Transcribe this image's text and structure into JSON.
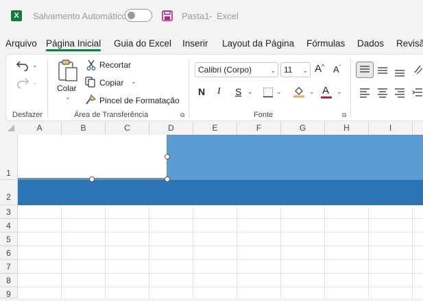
{
  "titlebar": {
    "logo": "X",
    "autosave_label": "Salvamento Automático",
    "autosave_state": "off",
    "filename": "Pasta1",
    "separator": "-",
    "app": "Excel"
  },
  "tabs": [
    {
      "label": "Arquivo"
    },
    {
      "label": "Página Inicial",
      "active": true
    },
    {
      "label": "Guia do Excel"
    },
    {
      "label": "Inserir"
    },
    {
      "label": "Layout da Página"
    },
    {
      "label": "Fórmulas"
    },
    {
      "label": "Dados"
    },
    {
      "label": "Revisão"
    }
  ],
  "ribbon": {
    "undo_group": {
      "label": "Desfazer"
    },
    "clipboard": {
      "label": "Área de Transferência",
      "paste": "Colar",
      "cut": "Recortar",
      "copy": "Copiar",
      "format_painter": "Pincel de Formatação"
    },
    "font": {
      "label": "Fonte",
      "family": "Calibri (Corpo)",
      "size": "11",
      "bold": "N",
      "italic": "I",
      "underline": "S",
      "grow": "A",
      "shrink": "A",
      "fill_color": "#f0ad4e",
      "font_color": "#e81123"
    }
  },
  "grid": {
    "columns": [
      "A",
      "B",
      "C",
      "D",
      "E",
      "F",
      "G",
      "H",
      "I"
    ],
    "rows": [
      "1",
      "2",
      "3",
      "4",
      "5",
      "6",
      "7",
      "8",
      "9"
    ],
    "band_colors": {
      "light": "#5b9bd5",
      "dark": "#2e75b6"
    }
  }
}
